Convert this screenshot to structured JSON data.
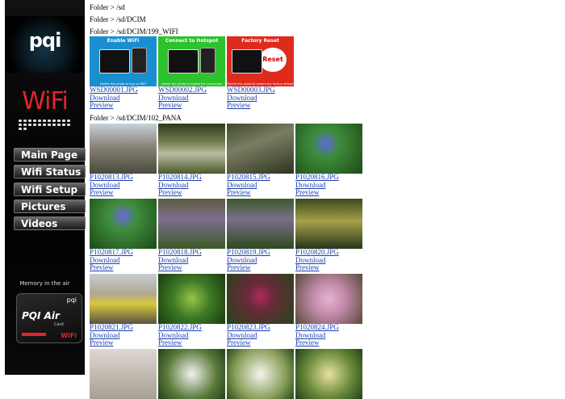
{
  "sidebar": {
    "logo": "pqi",
    "wifi": "WiFi",
    "nav": [
      {
        "label": "Main Page"
      },
      {
        "label": "Wifi Status"
      },
      {
        "label": "Wifi Setup"
      },
      {
        "label": "Pictures"
      },
      {
        "label": "Videos"
      }
    ],
    "tagline": "Memory in the air",
    "card": {
      "brand": "pqi",
      "name": "PQI Air",
      "sub": "Card",
      "wifi": "WiFi"
    }
  },
  "folders": {
    "f1": "Folder > /sd",
    "f2": "Folder > /sd/DCIM",
    "f3": "Folder > /sd/DCIM/199_WIFI",
    "f4": "Folder > /sd/DCIM/102_PANA"
  },
  "links": {
    "download": "Download",
    "preview": " Preview"
  },
  "wifi_files": [
    {
      "name": "WSD00001.JPG",
      "title": "Enable WiFi",
      "caption": "Delete this photo to turn on WiFi",
      "color": "#1a8fd0"
    },
    {
      "name": "WSD00002.JPG",
      "title": "Connect to Hotspot",
      "caption": "Delete this photo to enable the connection",
      "color": "#2cc22c"
    },
    {
      "name": "WSD00003.JPG",
      "title": "Factory Reset",
      "caption": "Delete this photo to restore the factory default",
      "color": "#e02a1c",
      "button": "Reset"
    }
  ],
  "pana_rows": [
    [
      {
        "name": "P1020813.JPG",
        "bg": "linear-gradient(180deg,#c7d2da 0%,#8a8478 45%,#4a4a3e 100%)"
      },
      {
        "name": "P1020814.JPG",
        "bg": "linear-gradient(180deg,#2d3a1c 0%,#6d7a4a 35%,#b8bca2 60%,#4b5a2a 100%)"
      },
      {
        "name": "P1020815.JPG",
        "bg": "linear-gradient(160deg,#3e4a2c 0%,#7b7d62 40%,#2d341e 100%)"
      },
      {
        "name": "P1020816.JPG",
        "bg": "radial-gradient(circle at 45% 40%,#5d6bd8 0%,#3c8c3a 30%,#1f4a18 100%)"
      }
    ],
    [
      {
        "name": "P1020817.JPG",
        "bg": "radial-gradient(circle at 50% 35%,#6a68d8 0%,#3f8e3c 30%,#1b4a16 100%)"
      },
      {
        "name": "P1020818.JPG",
        "bg": "linear-gradient(180deg,#5b5a3c 0%,#7e6e8e 40%,#3d5a28 100%)"
      },
      {
        "name": "P1020819.JPG",
        "bg": "linear-gradient(180deg,#3b5a28 0%,#7a6e8a 40%,#2e4a1e 100%)"
      },
      {
        "name": "P1020820.JPG",
        "bg": "linear-gradient(180deg,#3a4a1c 0%,#a6a04a 45%,#26361a 100%)"
      }
    ],
    [
      {
        "name": "P1020821.JPG",
        "bg": "linear-gradient(180deg,#c9cdd2 0%,#b0a890 40%,#d8c83a 60%,#5a5248 100%)"
      },
      {
        "name": "P1020822.JPG",
        "bg": "radial-gradient(circle at 50% 50%,#9ac24a 0%,#3e7a24 45%,#1a3a12 100%)"
      },
      {
        "name": "P1020823.JPG",
        "bg": "radial-gradient(circle at 50% 45%,#b02a5a 0%,#6a2a3a 30%,#24441a 100%)"
      },
      {
        "name": "P1020824.JPG",
        "bg": "radial-gradient(circle at 50% 50%,#e6b4d0 0%,#c08aa8 40%,#5a4a3a 100%)"
      }
    ],
    [
      {
        "name": "",
        "bg": "linear-gradient(180deg,#dcd8d2 0%,#a89e92 100%)"
      },
      {
        "name": "",
        "bg": "radial-gradient(circle at 50% 50%,#f2f2ee 0%,#5a7a3a 60%,#24401a 100%)"
      },
      {
        "name": "",
        "bg": "radial-gradient(circle at 50% 50%,#f5f5f0 0%,#8aa05a 60%,#2a4a1a 100%)"
      },
      {
        "name": "",
        "bg": "radial-gradient(circle at 50% 50%,#e8e2a0 0%,#6a8a3a 55%,#24401a 100%)"
      }
    ]
  ]
}
